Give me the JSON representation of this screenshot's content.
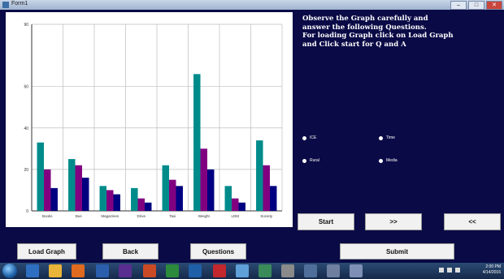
{
  "window": {
    "title": "Form1",
    "min_label": "–",
    "max_label": "□",
    "close_label": "✕"
  },
  "instructions": [
    "Observe the Graph carefully and",
    "answer the following Questions.",
    "For loading Graph click on Load Graph",
    "and Click start for Q and A"
  ],
  "options": [
    "ICE",
    "Time",
    "Rural",
    "Media"
  ],
  "buttons": {
    "start": "Start",
    "next": ">>",
    "prev": "<<",
    "load_graph": "Load Graph",
    "back": "Back",
    "questions": "Questions",
    "submit": "Submit"
  },
  "chart_data": {
    "type": "bar",
    "categories": [
      "Books",
      "Bus",
      "Magazines",
      "Drive",
      "Taxi",
      "Weight",
      "LDM",
      "Society"
    ],
    "ylim": [
      0,
      90
    ],
    "yticks": [
      0,
      20,
      40,
      60,
      90
    ],
    "grid": true,
    "series": [
      {
        "values": [
          33,
          25,
          12,
          11,
          22,
          66,
          12,
          34
        ],
        "color": "#008b8b"
      },
      {
        "values": [
          20,
          22,
          10,
          6,
          15,
          30,
          6,
          22
        ],
        "color": "#800080"
      },
      {
        "values": [
          11,
          16,
          8,
          4,
          12,
          20,
          4,
          12
        ],
        "color": "#000080"
      }
    ]
  },
  "taskbar": {
    "time": "2:00 PM",
    "date": "4/14/2016",
    "icons": [
      "ie-icon",
      "explorer-icon",
      "media-player-icon",
      "word-icon",
      "excel-icon",
      "powerpoint-icon",
      "visual-studio-icon",
      "paint-icon",
      "chrome-icon",
      "settings-icon",
      "app-icon",
      "app-icon-2"
    ]
  }
}
